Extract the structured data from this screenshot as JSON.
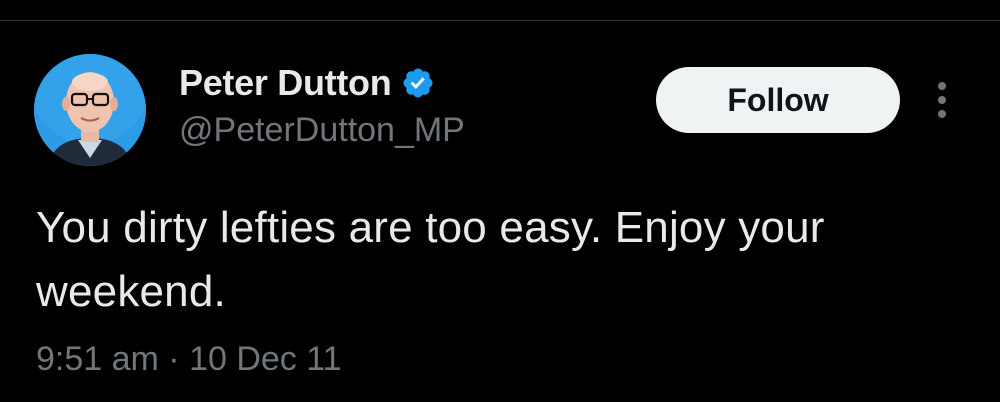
{
  "tweet": {
    "author": {
      "display_name": "Peter Dutton",
      "handle": "@PeterDutton_MP",
      "verified": true,
      "avatar_icon": "profile-photo",
      "verified_icon": "verified-badge-icon"
    },
    "follow_label": "Follow",
    "more_icon": "more-options-icon",
    "text": "You dirty lefties are too easy. Enjoy your weekend.",
    "timestamp": "9:51 am · 10 Dec 11"
  },
  "colors": {
    "background": "#000000",
    "primary_text": "#e7e9ea",
    "secondary_text": "#71767b",
    "verified_blue": "#1d9bf0",
    "follow_button_bg": "#eff3f4",
    "follow_button_text": "#0f1419",
    "avatar_bg": "#2d9ce6"
  }
}
